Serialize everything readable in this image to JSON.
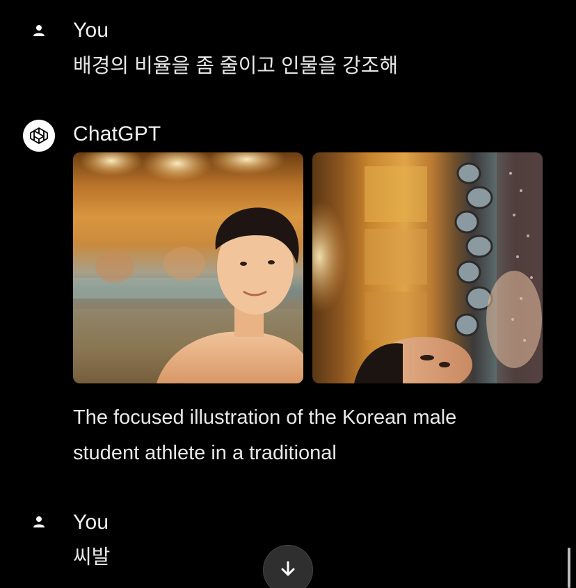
{
  "messages": [
    {
      "role": "user",
      "sender": "You",
      "text": "배경의 비율을 좀 줄이고 인물을 강조해"
    },
    {
      "role": "assistant",
      "sender": "ChatGPT",
      "images": [
        {
          "description_icon": "generated-image-1"
        },
        {
          "description_icon": "generated-image-2"
        }
      ],
      "text_line1": "The focused illustration of the Korean male",
      "text_line2": "student athlete in a traditional"
    },
    {
      "role": "user",
      "sender": "You",
      "text": "씨발"
    }
  ],
  "icons": {
    "user_avatar": "person-icon",
    "bot_avatar": "openai-logo-icon",
    "scroll_down": "arrow-down-icon"
  },
  "colors": {
    "background": "#000000",
    "text": "#ececec",
    "scroll_button": "#2f2f2f"
  }
}
